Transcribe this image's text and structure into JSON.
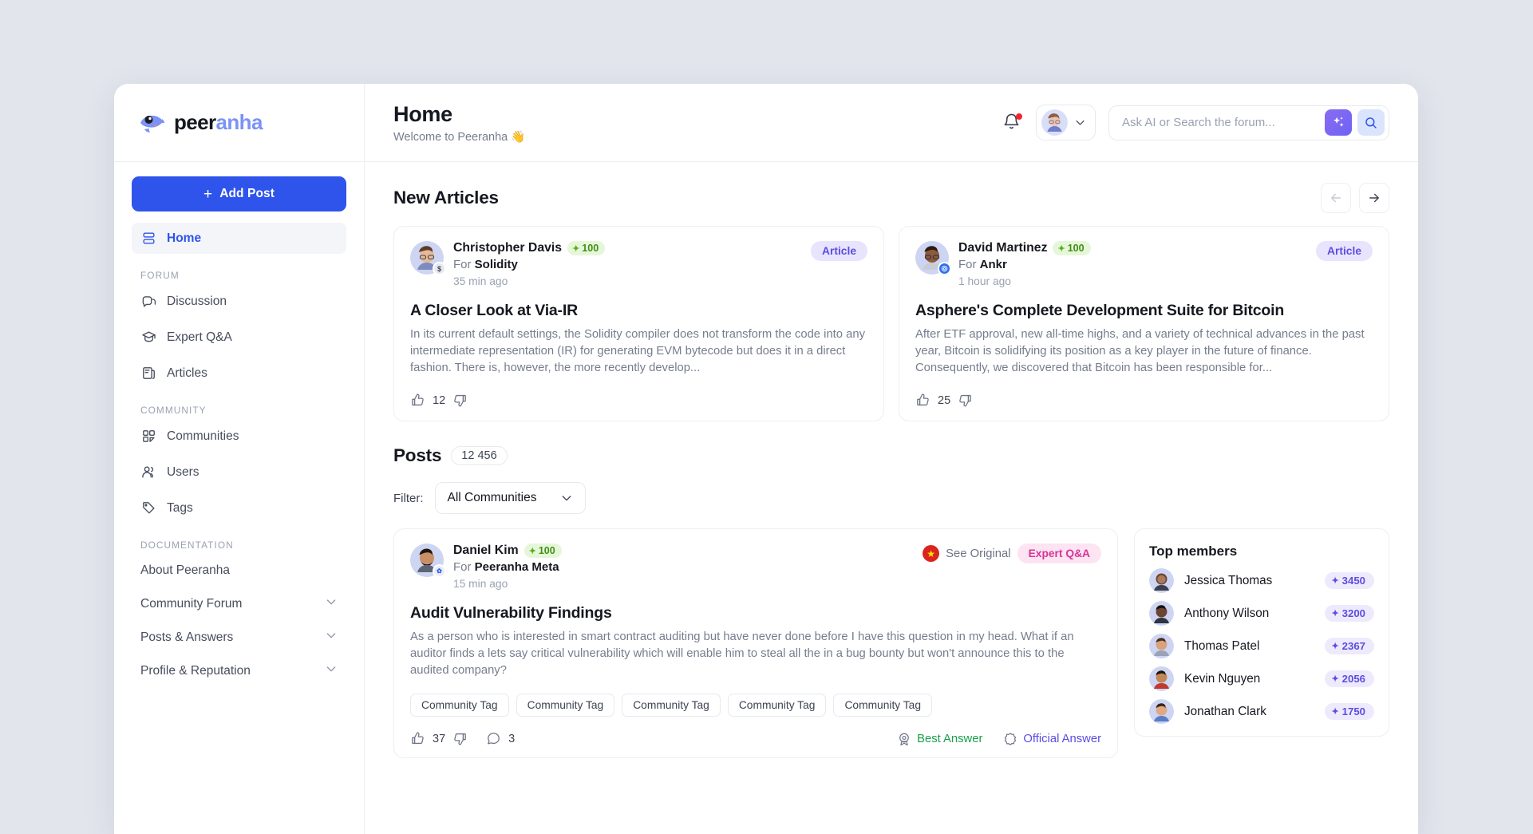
{
  "brand": {
    "name_part1": "peer",
    "name_part2": "anha",
    "logo_icon": "piranha-fish-logo"
  },
  "sidebar": {
    "add_post_label": "Add Post",
    "home": {
      "label": "Home",
      "icon": "home-stack-icon"
    },
    "sections": [
      {
        "title": "FORUM",
        "items": [
          {
            "label": "Discussion",
            "icon": "chat-bubbles-icon"
          },
          {
            "label": "Expert Q&A",
            "icon": "graduation-cap-icon"
          },
          {
            "label": "Articles",
            "icon": "article-page-icon"
          }
        ]
      },
      {
        "title": "COMMUNITY",
        "items": [
          {
            "label": "Communities",
            "icon": "grid-squares-icon"
          },
          {
            "label": "Users",
            "icon": "users-icon"
          },
          {
            "label": "Tags",
            "icon": "tag-icon"
          }
        ]
      }
    ],
    "documentation": {
      "title": "DOCUMENTATION",
      "items": [
        {
          "label": "About Peeranha",
          "expandable": false
        },
        {
          "label": "Community Forum",
          "expandable": true
        },
        {
          "label": "Posts & Answers",
          "expandable": true
        },
        {
          "label": "Profile & Reputation",
          "expandable": true
        }
      ]
    }
  },
  "header": {
    "title": "Home",
    "subtitle": "Welcome to Peeranha 👋",
    "bell_icon": "notification-bell-icon",
    "has_notification": true,
    "avatar_icon": "user-avatar",
    "chevron_icon": "chevron-down-icon"
  },
  "search": {
    "placeholder": "Ask AI or Search the forum...",
    "value": "",
    "ai_icon": "sparkles-icon",
    "search_icon": "magnifier-icon"
  },
  "new_articles": {
    "title": "New Articles",
    "prev_icon": "arrow-left-icon",
    "next_icon": "arrow-right-icon",
    "cards": [
      {
        "author": "Christopher Davis",
        "reputation": "100",
        "for_label": "For",
        "community": "Solidity",
        "time": "35 min ago",
        "type": "Article",
        "title": "A Closer Look at Via-IR",
        "body": "In its current default settings, the Solidity compiler does not transform the code into any intermediate representation (IR) for generating EVM bytecode but does it in a direct fashion. There is, however, the more recently develop...",
        "likes": "12"
      },
      {
        "author": "David Martinez",
        "reputation": "100",
        "for_label": "For",
        "community": "Ankr",
        "time": "1 hour ago",
        "type": "Article",
        "title": "Asphere's Complete Development Suite for Bitcoin",
        "body": "After ETF approval, new all-time highs, and a variety of technical advances in the past year, Bitcoin is solidifying its position as a key player in the future of finance. Consequently, we discovered that Bitcoin has been responsible for...",
        "likes": "25"
      }
    ]
  },
  "posts": {
    "title": "Posts",
    "count": "12 456",
    "filter_label": "Filter:",
    "filter_value": "All Communities",
    "filter_chevron": "chevron-down-icon",
    "card": {
      "author": "Daniel Kim",
      "reputation": "100",
      "for_label": "For",
      "community": "Peeranha Meta",
      "time": "15 min ago",
      "see_original": "See Original",
      "flag_icon": "vietnam-flag-icon",
      "type": "Expert Q&A",
      "title": "Audit Vulnerability Findings",
      "body": "As a person who is interested in smart contract auditing but have never done before I have this question in my head. What if an auditor finds a lets say critical vulnerability which will enable him to steal all the in a bug bounty but won't announce this to the audited company?",
      "tags": [
        "Community Tag",
        "Community Tag",
        "Community Tag",
        "Community Tag",
        "Community Tag"
      ],
      "likes": "37",
      "comments": "3",
      "best_answer": "Best Answer",
      "official_answer": "Official Answer"
    }
  },
  "top_members": {
    "title": "Top members",
    "members": [
      {
        "name": "Jessica Thomas",
        "score": "3450"
      },
      {
        "name": "Anthony Wilson",
        "score": "3200"
      },
      {
        "name": "Thomas Patel",
        "score": "2367"
      },
      {
        "name": "Kevin Nguyen",
        "score": "2056"
      },
      {
        "name": "Jonathan Clark",
        "score": "1750"
      }
    ]
  },
  "colors": {
    "accent": "#2f54eb",
    "brand_light": "#7b93f5",
    "article_pill": "#5b4de0",
    "qa_pill": "#d6349a",
    "rep_green": "#3f8f16",
    "best_answer": "#1a9e4b",
    "official_answer": "#5b4de0"
  }
}
